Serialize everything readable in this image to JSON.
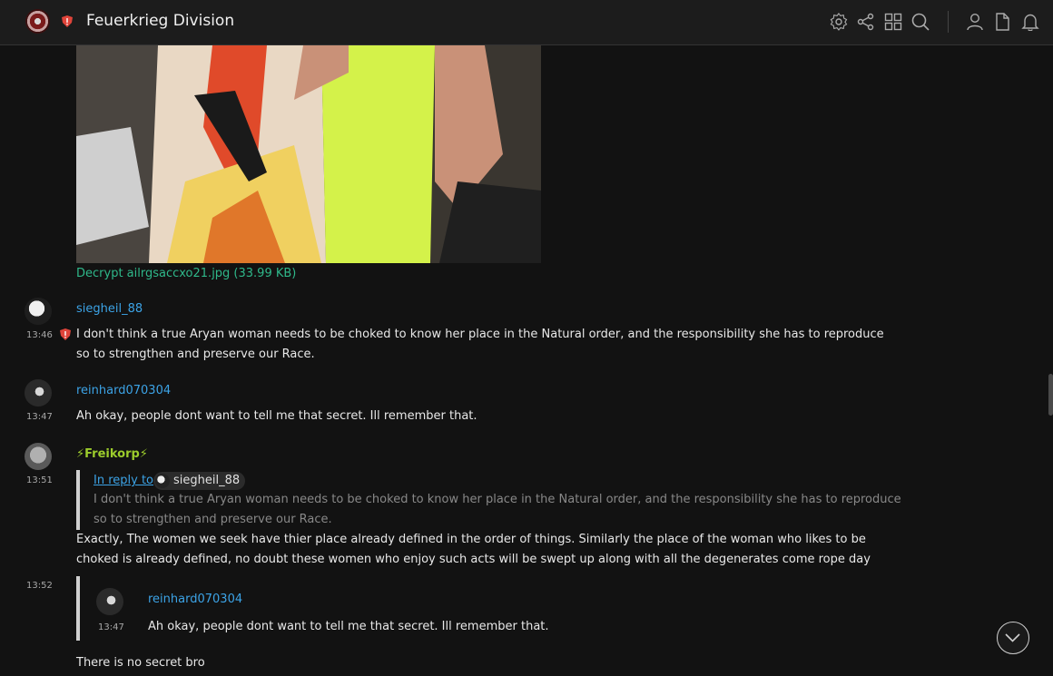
{
  "header": {
    "room_name": "Feuerkrieg Division",
    "icons": [
      "room-avatar",
      "shield-icon",
      "settings-icon",
      "share-icon",
      "apps-icon",
      "search-icon",
      "person-icon",
      "file-icon",
      "bell-icon"
    ]
  },
  "media": {
    "file_label": "Decrypt ailrgsaccxo21.jpg (33.99 KB)"
  },
  "messages": [
    {
      "sender": "siegheil_88",
      "time": "13:46",
      "body": "I don't think a true Aryan woman needs to be choked to know her place in the Natural order, and the responsibility she has to reproduce so to strengthen and preserve our Race."
    },
    {
      "sender": "reinhard070304",
      "time": "13:47",
      "body": "Ah okay, people dont want to tell me that secret. Ill remember that."
    },
    {
      "sender": "⚡Freikorp⚡",
      "time": "13:51",
      "reply_label": "In reply to",
      "reply_user": "siegheil_88",
      "quoted": "I don't think a true Aryan woman needs to be choked to know her place in the Natural order, and the responsibility she has to reproduce so to strengthen and preserve our Race.",
      "body": "Exactly, The women we seek have thier place already defined in the order of things. Similarly the place of the woman who likes to be choked is already defined, no doubt these women who enjoy such acts will be swept up along with all the degenerates come rope day"
    },
    {
      "time": "13:52",
      "quote_sender": "reinhard070304",
      "quote_time": "13:47",
      "quote_body": "Ah okay, people dont want to tell me that secret. Ill remember that.",
      "body": "There is no secret bro"
    }
  ],
  "colors": {
    "background": "#121212",
    "header": "#1c1c1c",
    "sender": "#3ca3e6",
    "file_link": "#2fb88a",
    "freikorp": "#9ccc2c",
    "shield": "#e0443a"
  }
}
